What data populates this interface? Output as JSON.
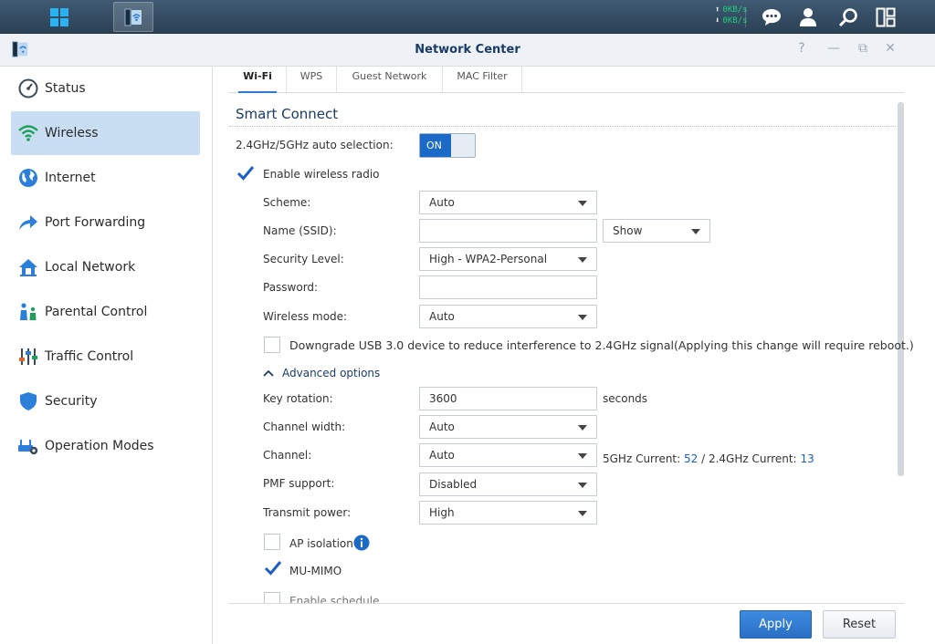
{
  "topbar": {
    "upload_speed": "0KB/s",
    "download_speed": "0KB/s",
    "icons": [
      "main-menu-icon",
      "network-center-app-icon",
      "notifications-icon",
      "user-icon",
      "search-icon",
      "widgets-icon"
    ]
  },
  "window": {
    "title": "Network Center",
    "controls": [
      "help-icon",
      "minimize-icon",
      "maximize-icon",
      "close-icon"
    ]
  },
  "sidebar": {
    "items": [
      {
        "label": "Status",
        "icon": "gauge-icon"
      },
      {
        "label": "Wireless",
        "icon": "wifi-icon",
        "active": true
      },
      {
        "label": "Internet",
        "icon": "globe-icon"
      },
      {
        "label": "Port Forwarding",
        "icon": "arrow-icon"
      },
      {
        "label": "Local Network",
        "icon": "house-icon"
      },
      {
        "label": "Parental Control",
        "icon": "family-icon"
      },
      {
        "label": "Traffic Control",
        "icon": "sliders-icon"
      },
      {
        "label": "Security",
        "icon": "shield-icon"
      },
      {
        "label": "Operation Modes",
        "icon": "router-gear-icon"
      }
    ]
  },
  "tabs": [
    "Wi-Fi",
    "WPS",
    "Guest Network",
    "MAC Filter"
  ],
  "form": {
    "section_title": "Smart Connect",
    "auto_selection_label": "2.4GHz/5GHz auto selection:",
    "toggle_on": "ON",
    "enable_radio_label": "Enable wireless radio",
    "scheme_label": "Scheme:",
    "scheme_value": "Auto",
    "ssid_label": "Name (SSID):",
    "ssid_value": "",
    "ssid_visibility": "Show",
    "security_label": "Security Level:",
    "security_value": "High - WPA2-Personal",
    "password_label": "Password:",
    "password_value": "",
    "wireless_mode_label": "Wireless mode:",
    "wireless_mode_value": "Auto",
    "downgrade_label": "Downgrade USB 3.0 device to reduce interference to 2.4GHz signal(Applying this change will require reboot.)",
    "advanced_label": "Advanced options",
    "key_rotation_label": "Key rotation:",
    "key_rotation_value": "3600",
    "key_rotation_unit": "seconds",
    "channel_width_label": "Channel width:",
    "channel_width_value": "Auto",
    "channel_label": "Channel:",
    "channel_value": "Auto",
    "channel_5g_prefix": "5GHz Current:",
    "channel_5g": "52",
    "channel_sep": " / 2.4GHz Current:",
    "channel_24g": "13",
    "pmf_label": "PMF support:",
    "pmf_value": "Disabled",
    "transmit_label": "Transmit power:",
    "transmit_value": "High",
    "ap_isolation_label": "AP isolation",
    "mu_mimo_label": "MU-MIMO",
    "schedule_label": "Enable schedule"
  },
  "buttons": {
    "apply": "Apply",
    "reset": "Reset"
  },
  "colors": {
    "accent": "#1b6ac8",
    "sidebar_active": "#c9def3",
    "speed": "#1fd07a"
  }
}
